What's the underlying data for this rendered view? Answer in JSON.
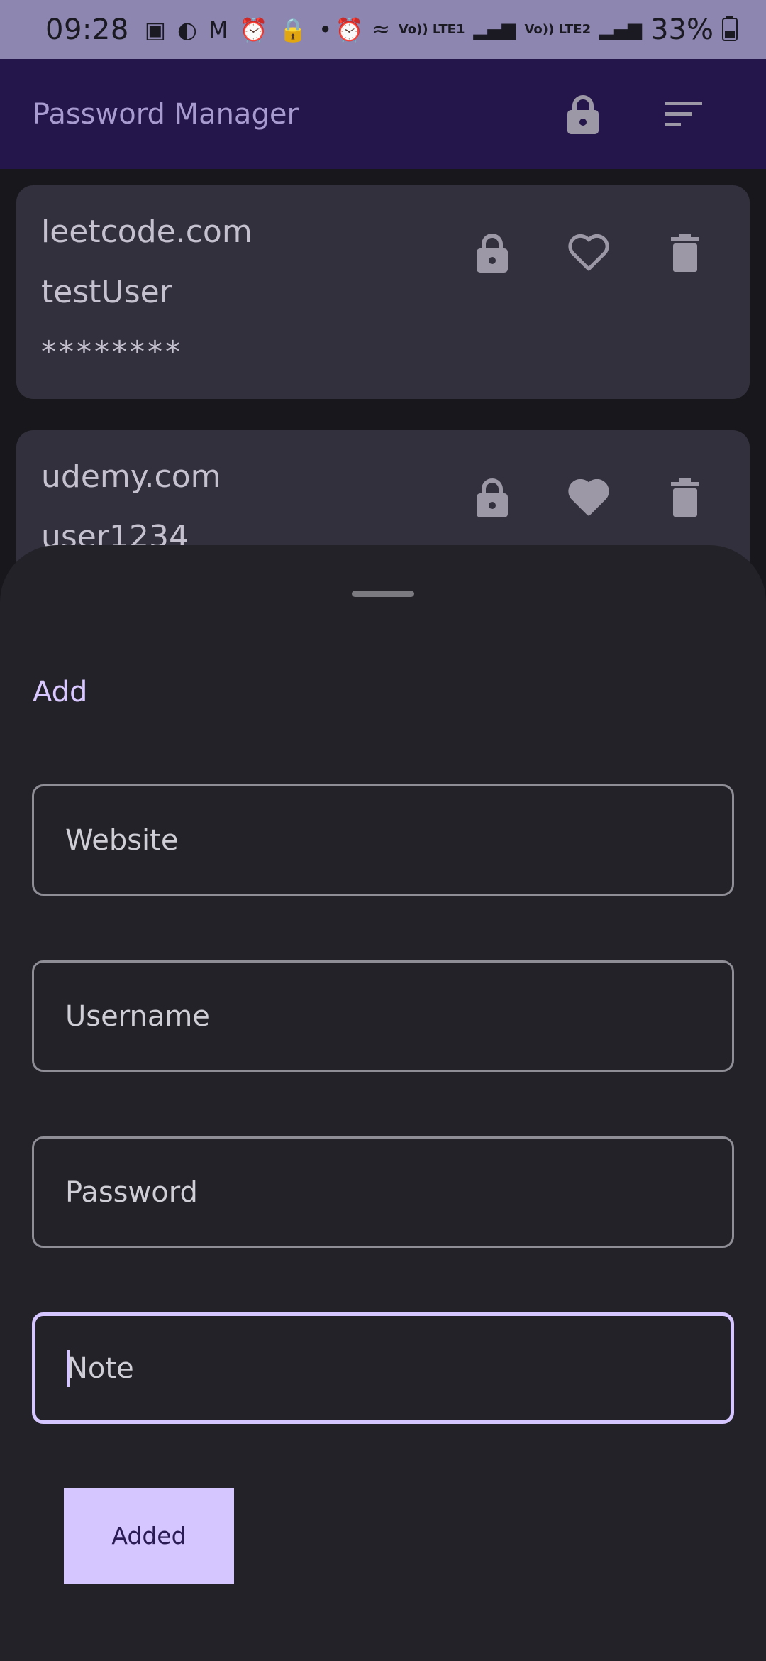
{
  "status_bar": {
    "time": "09:28",
    "left_icons": [
      "s-icon",
      "weather-icon",
      "gmail-icon",
      "alarm-icon",
      "lock-icon",
      "dot-icon"
    ],
    "signal1": "Vo)) LTE1",
    "signal2": "Vo)) LTE2",
    "battery": "33%"
  },
  "app_bar": {
    "title": "Password Manager",
    "icons": [
      "lock-icon",
      "sort-icon"
    ]
  },
  "entries": [
    {
      "website": "leetcode.com",
      "username": "testUser",
      "password": "********",
      "favorite": false
    },
    {
      "website": "udemy.com",
      "username": "user1234",
      "password": "********",
      "favorite": true
    }
  ],
  "sheet": {
    "title": "Add",
    "fields": {
      "website_placeholder": "Website",
      "username_placeholder": "Username",
      "password_placeholder": "Password",
      "note_placeholder": "Note"
    },
    "submit_label": "Added"
  },
  "colors": {
    "status_bar": "#8d86b0",
    "app_bar": "#24154a",
    "card": "#33303d",
    "sheet": "#232228",
    "accent": "#d6c6ff"
  }
}
